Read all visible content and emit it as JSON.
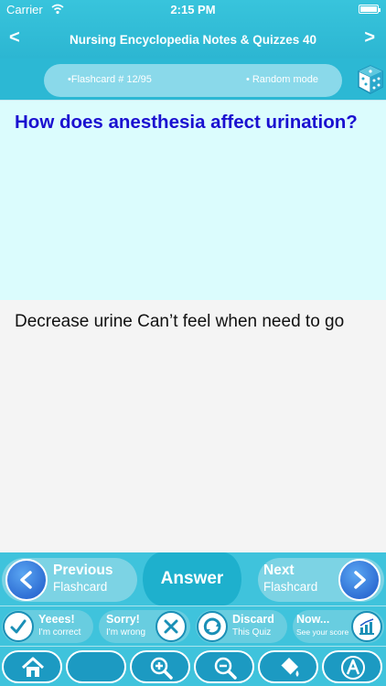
{
  "status": {
    "carrier": "Carrier",
    "time": "2:15 PM"
  },
  "nav": {
    "back": "<",
    "title": "Nursing Encyclopedia Notes & Quizzes 40",
    "forward": ">"
  },
  "mode": {
    "counter": "•Flashcard #  12/95",
    "mode": "• Random mode",
    "dice_icon": "dice-icon"
  },
  "flashcard": {
    "question": "How does anesthesia affect urination?",
    "answer": "Decrease urine Can’t feel when need to go"
  },
  "controls": {
    "previous": {
      "line1": "Previous",
      "line2": "Flashcard"
    },
    "answer": "Answer",
    "next": {
      "line1": "Next",
      "line2": "Flashcard"
    }
  },
  "actions": [
    {
      "line1": "Yeees!",
      "line2": "I'm correct",
      "icon": "check-icon"
    },
    {
      "line1": "Sorry!",
      "line2": "I'm wrong",
      "icon": "x-icon"
    },
    {
      "line1": "Discard",
      "line2": "This Quiz",
      "icon": "recycle-icon"
    },
    {
      "line1": "Now...",
      "line2": "See your score",
      "icon": "chart-icon"
    }
  ],
  "tools": [
    "home-icon",
    "blank-icon",
    "zoom-in-icon",
    "zoom-out-icon",
    "paint-bucket-icon",
    "font-icon"
  ],
  "colors": {
    "accent": "#2cb8d4",
    "question_bg": "#dbfcfd",
    "question_text": "#1a10d0",
    "button_blue": "#1d57c8"
  }
}
